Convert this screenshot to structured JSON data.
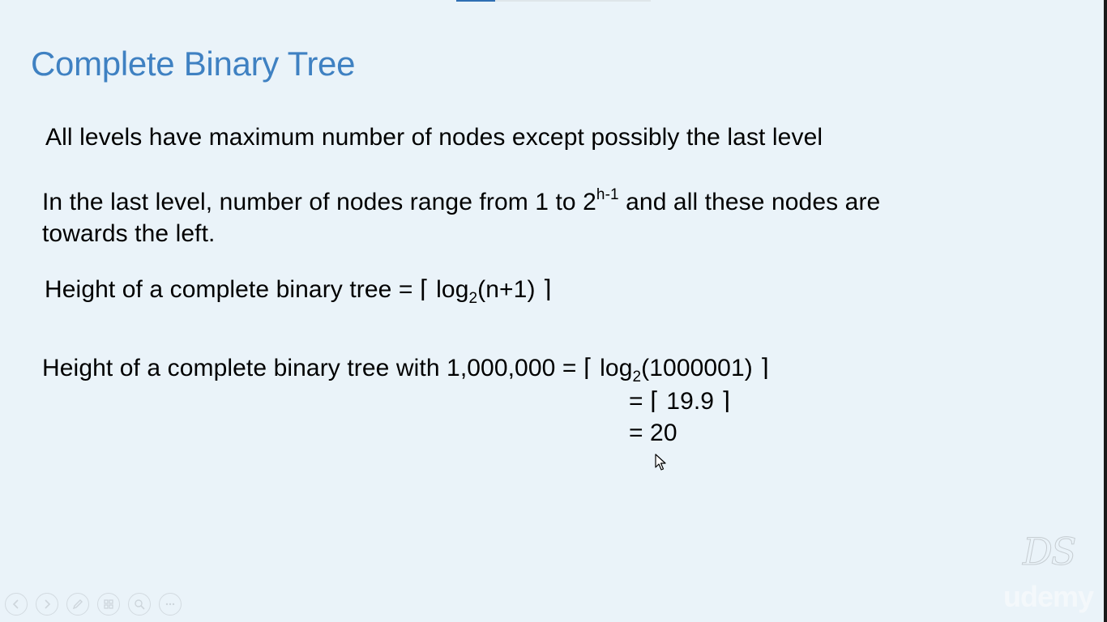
{
  "slide": {
    "title": "Complete Binary Tree",
    "line1": "All levels have maximum number of nodes except possibly the last level",
    "line2": {
      "part1": "In the last level, number of nodes range from 1 to 2",
      "sup": "h-1",
      "part2": " and all these nodes are"
    },
    "line3": "towards the left.",
    "line4": {
      "part1": "Height of a complete binary tree = ⌈ log",
      "sub": "2",
      "part2": "(n+1) ⌉"
    },
    "line5": {
      "part1": "Height of a complete binary tree with 1,000,000 = ⌈ log",
      "sub": "2",
      "part2": "(1000001) ⌉"
    },
    "line6": "= ⌈ 19.9 ⌉",
    "line7": "= 20"
  },
  "watermarks": {
    "monogram": "DS",
    "brand": "udemy"
  },
  "player": {
    "progress_fraction": 0.2,
    "controls": [
      "previous-icon",
      "next-icon",
      "pen-icon",
      "slides-grid-icon",
      "zoom-icon",
      "more-icon"
    ]
  },
  "colors": {
    "background": "#eaf3f9",
    "title": "#3f81c2",
    "text": "#000000",
    "progress": "#2f6fb3"
  }
}
